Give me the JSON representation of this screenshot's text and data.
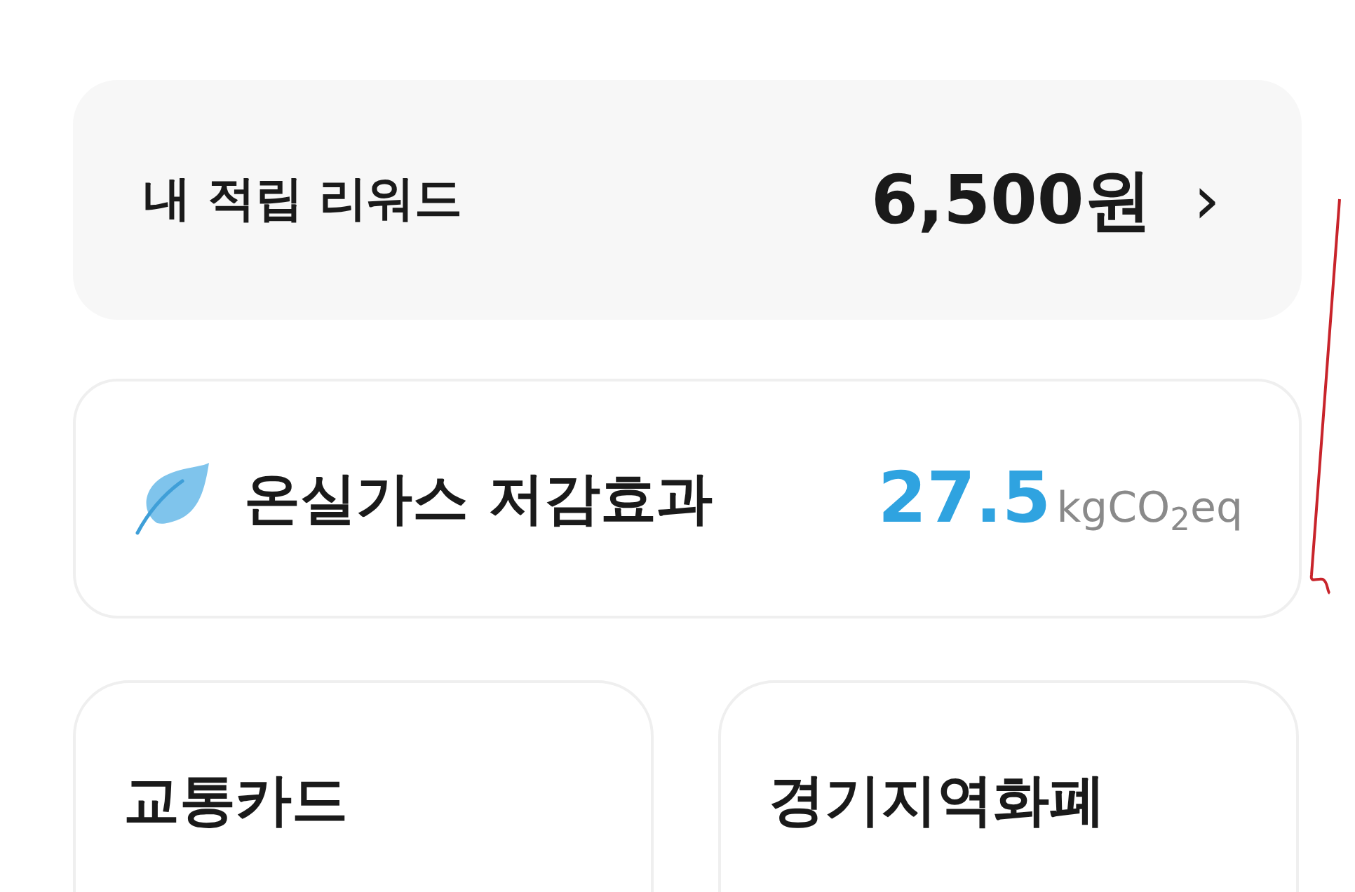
{
  "rewards": {
    "label": "내 적립 리워드",
    "amount": "6,500원",
    "chevron": "›"
  },
  "reduction": {
    "label": "온실가스 저감효과",
    "value": "27.5",
    "unit": "kgCO$_{2}$eq"
  },
  "cards": [
    {
      "title": "교통카드"
    },
    {
      "title": "경기지역화폐"
    }
  ]
}
